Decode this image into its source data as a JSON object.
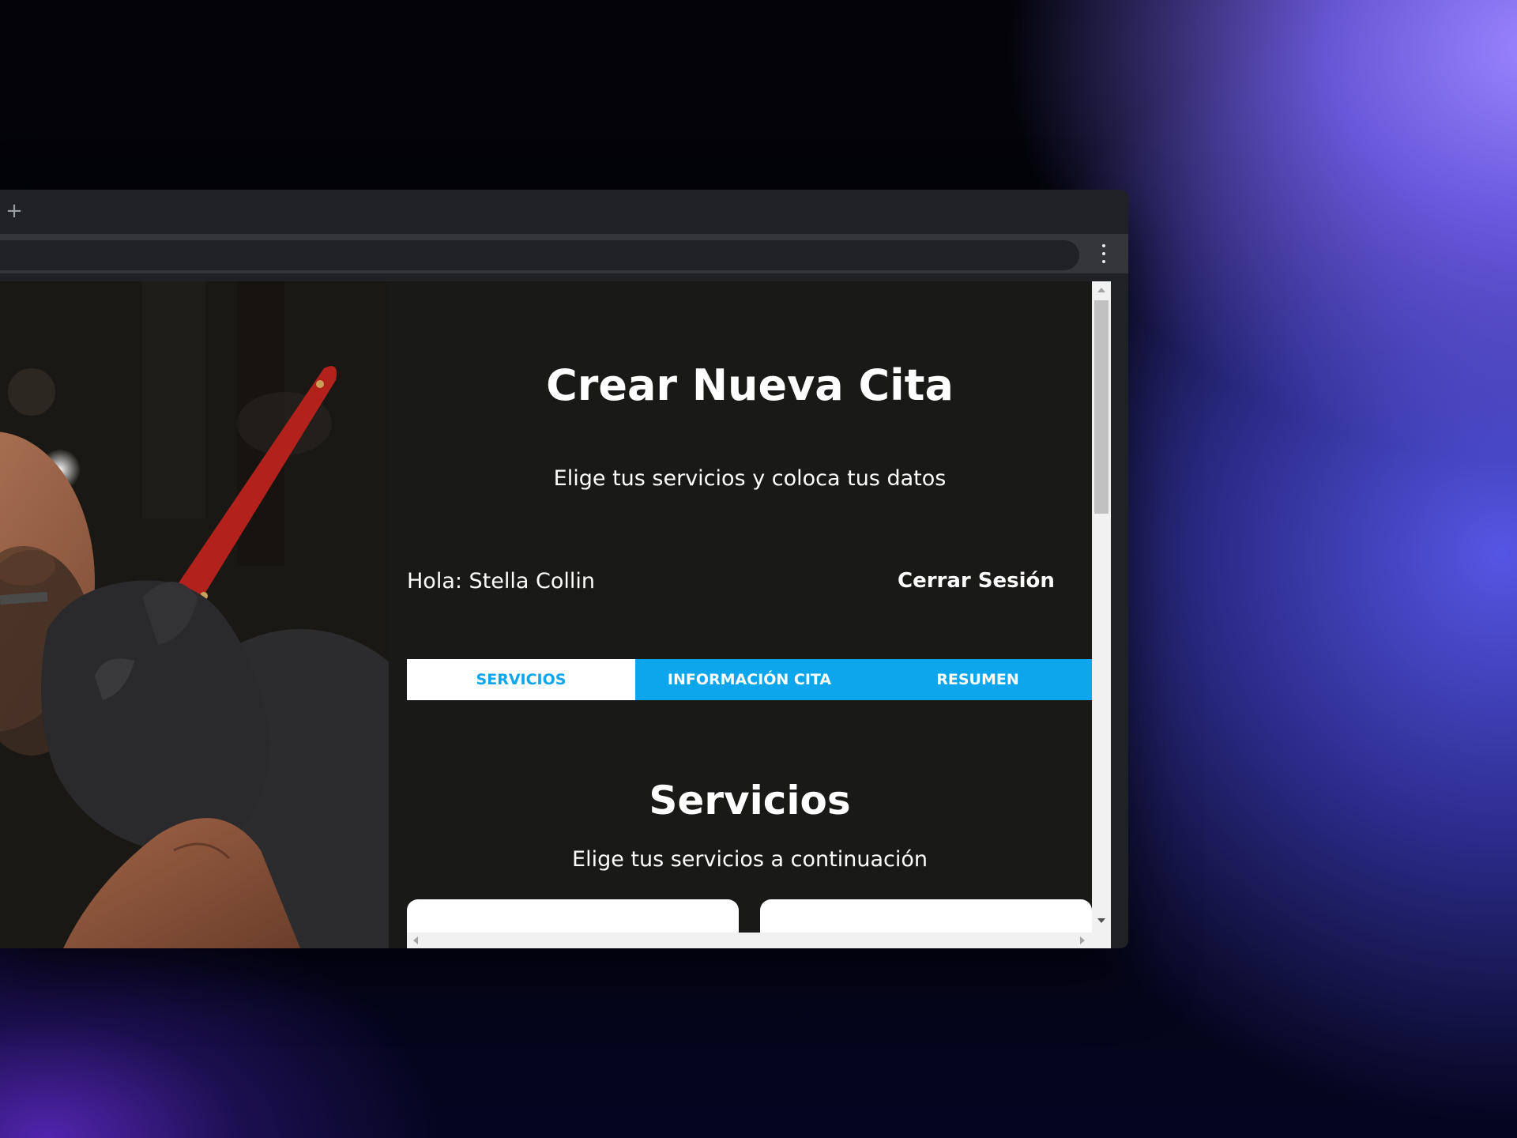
{
  "browser": {
    "new_tab_symbol": "+",
    "menu_icon": "kebab-menu-icon"
  },
  "header": {
    "title": "Crear Nueva Cita",
    "subtitle": "Elige tus servicios y coloca tus datos"
  },
  "user_bar": {
    "greeting": "Hola: Stella Collin",
    "logout_label": "Cerrar Sesión"
  },
  "tabs": [
    {
      "label": "SERVICIOS",
      "active": true
    },
    {
      "label": "INFORMACIÓN CITA",
      "active": false
    },
    {
      "label": "RESUMEN",
      "active": false
    }
  ],
  "services": {
    "title": "Servicios",
    "subtitle": "Elige tus servicios a continuación"
  },
  "colors": {
    "accent": "#0da6ec",
    "page_background": "#191917",
    "text": "#ffffff",
    "razor_handle": "#b3211c"
  },
  "hero_image": {
    "subject": "barber-shaving-photo"
  }
}
